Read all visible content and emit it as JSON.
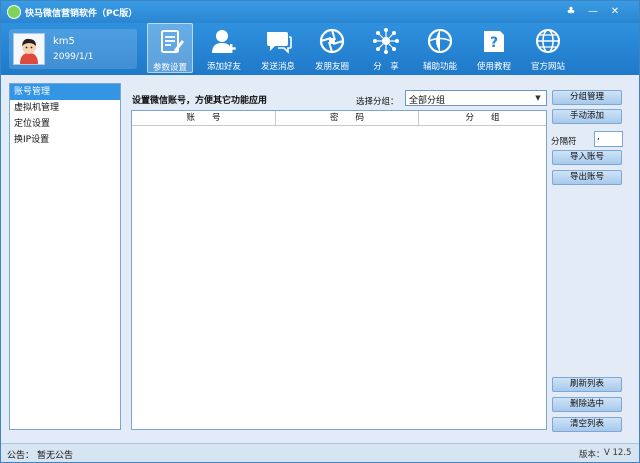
{
  "app": {
    "title": "快马微信营销软件（PC版）"
  },
  "window_controls": {
    "skin": "♣",
    "minimize": "—",
    "close": "✕"
  },
  "user": {
    "name": "km5",
    "date": "2099/1/1"
  },
  "nav": [
    {
      "label": "参数设置",
      "icon": "settings-doc-icon",
      "active": true
    },
    {
      "label": "添加好友",
      "icon": "add-user-icon",
      "active": false
    },
    {
      "label": "发送消息",
      "icon": "message-icon",
      "active": false
    },
    {
      "label": "发朋友圈",
      "icon": "moments-icon",
      "active": false
    },
    {
      "label": "分　享",
      "icon": "share-icon",
      "active": false
    },
    {
      "label": "辅助功能",
      "icon": "assist-icon",
      "active": false
    },
    {
      "label": "使用教程",
      "icon": "tutorial-icon",
      "active": false
    },
    {
      "label": "官方网站",
      "icon": "globe-icon",
      "active": false
    }
  ],
  "sidebar": {
    "items": [
      {
        "label": "账号管理",
        "selected": true
      },
      {
        "label": "虚拟机管理",
        "selected": false
      },
      {
        "label": "定位设置",
        "selected": false
      },
      {
        "label": "换IP设置",
        "selected": false
      }
    ]
  },
  "main": {
    "hint": "设置微信账号，方便其它功能应用",
    "group_label": "选择分组：",
    "group_select": "全部分组",
    "columns": [
      "账　　号",
      "密　　码",
      "分　　组"
    ]
  },
  "right_panel": {
    "group_manage": "分组管理",
    "manual_add": "手动添加",
    "separator_label": "分隔符",
    "separator_value": ",",
    "import": "导入账号",
    "export": "导出账号",
    "refresh": "刷新列表",
    "delete_selected": "删除选中",
    "clear": "清空列表"
  },
  "status": {
    "notice_label": "公告：",
    "notice_text": "暂无公告",
    "version_label": "版本：",
    "version_value": "V 12.5"
  },
  "colors": {
    "header": "#2a86d2",
    "selected": "#3395e4",
    "button": "#b9d6f2"
  }
}
